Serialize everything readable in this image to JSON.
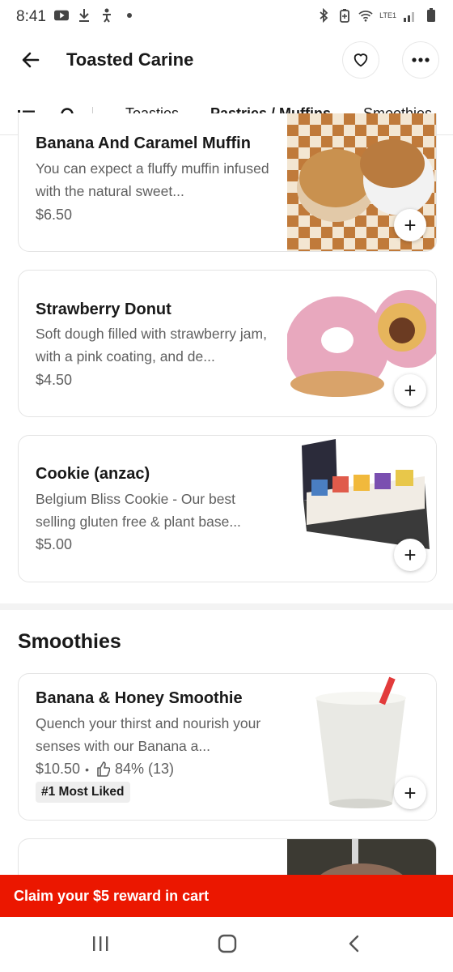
{
  "status_bar": {
    "time": "8:41",
    "icons_left": [
      "youtube-icon",
      "download-icon",
      "accessibility-icon",
      "dot-icon"
    ],
    "icons_right": [
      "bluetooth-icon",
      "battery-saver-icon",
      "wifi-icon",
      "lte-signal-icon",
      "battery-icon"
    ],
    "network_label": "LTE1"
  },
  "header": {
    "title": "Toasted Carine",
    "back_icon": "arrow-left-icon",
    "favorite_icon": "heart-icon",
    "more_icon": "more-dots-icon"
  },
  "tabs": {
    "items": [
      {
        "label": "Toasties",
        "active": false
      },
      {
        "label": "Pastries / Muffins",
        "active": true
      },
      {
        "label": "Smoothies",
        "active": false
      }
    ]
  },
  "menu": {
    "pastries": [
      {
        "name": "Banana And Caramel Muffin",
        "description": "You can expect a fluffy muffin infused with the natural sweet...",
        "price": "$6.50"
      },
      {
        "name": "Strawberry Donut",
        "description": "Soft dough filled with strawberry jam, with a pink coating, and de...",
        "price": "$4.50"
      },
      {
        "name": "Cookie (anzac)",
        "description": "Belgium Bliss Cookie - Our best selling gluten free & plant base...",
        "price": "$5.00"
      }
    ],
    "smoothies_section_title": "Smoothies",
    "smoothies": [
      {
        "name": "Banana & Honey Smoothie",
        "description": "Quench your thirst and nourish your senses with our Banana a...",
        "price": "$10.50",
        "separator": "•",
        "rating": "84% (13)",
        "badge": "#1 Most Liked"
      }
    ]
  },
  "add_button_label": "+",
  "reward_banner": {
    "text": "Claim your $5 reward in cart",
    "color": "#eb1700"
  },
  "nav_bar": {
    "icons": [
      "recent-apps-icon",
      "home-icon",
      "back-icon"
    ]
  }
}
